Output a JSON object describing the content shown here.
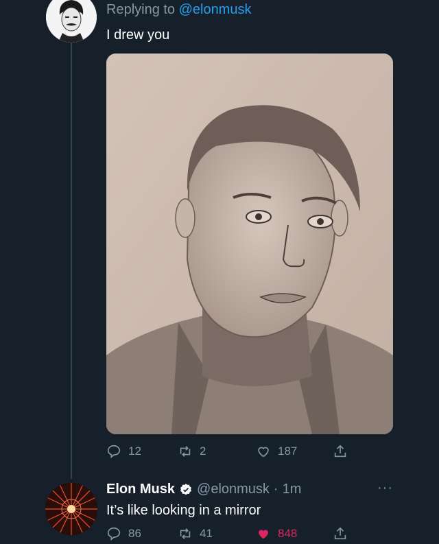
{
  "reply_context": {
    "prefix": "Replying to",
    "handle": "@elonmusk"
  },
  "original_tweet": {
    "text": "I drew you",
    "image_alt": "pencil sketch portrait",
    "stats": {
      "replies": "12",
      "retweets": "2",
      "likes": "187"
    }
  },
  "reply_tweet": {
    "author_name": "Elon Musk",
    "verified": true,
    "handle": "@elonmusk",
    "separator": "·",
    "time": "1m",
    "text": "It’s like looking in a mirror",
    "stats": {
      "replies": "86",
      "retweets": "41",
      "likes": "848",
      "liked": true
    }
  },
  "more_label": "···",
  "colors": {
    "background": "#15202b",
    "accent": "#1da1f2",
    "secondary_text": "#8899a6",
    "like_active": "#e0245e"
  }
}
